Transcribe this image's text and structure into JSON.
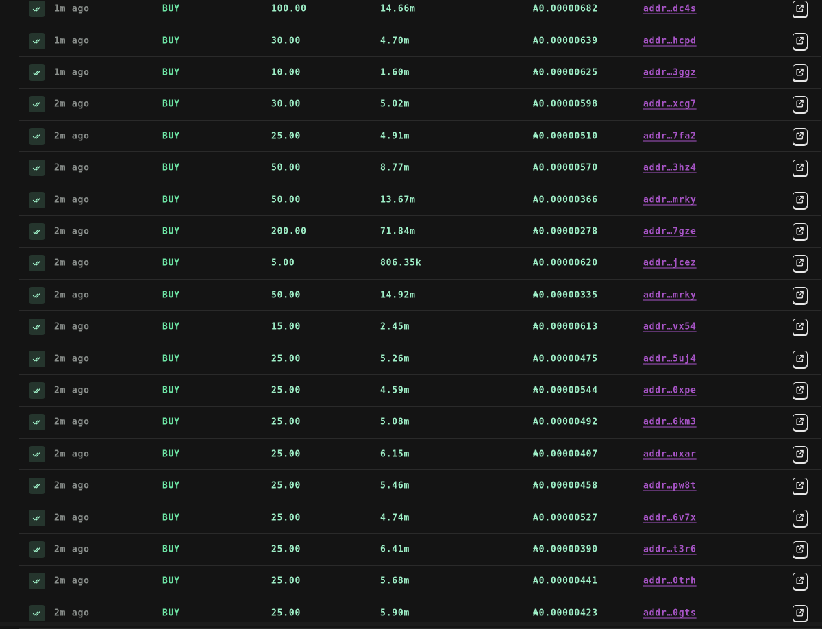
{
  "colors": {
    "background": "#141414",
    "time": "#8a8f8c",
    "type": "#6ee7a6",
    "value": "#9ff0c8",
    "address": "#a855c7",
    "status_bg": "#25352d",
    "divider": "#2a2a2a"
  },
  "icons": {
    "status": "double-check-icon",
    "action": "external-link-icon"
  },
  "trades": [
    {
      "time": "1m ago",
      "type": "BUY",
      "amount": "100.00",
      "tokens": "14.66m",
      "price": "₳0.00000682",
      "address": "addr…dc4s"
    },
    {
      "time": "1m ago",
      "type": "BUY",
      "amount": "30.00",
      "tokens": "4.70m",
      "price": "₳0.00000639",
      "address": "addr…hcpd"
    },
    {
      "time": "1m ago",
      "type": "BUY",
      "amount": "10.00",
      "tokens": "1.60m",
      "price": "₳0.00000625",
      "address": "addr…3ggz"
    },
    {
      "time": "2m ago",
      "type": "BUY",
      "amount": "30.00",
      "tokens": "5.02m",
      "price": "₳0.00000598",
      "address": "addr…xcg7"
    },
    {
      "time": "2m ago",
      "type": "BUY",
      "amount": "25.00",
      "tokens": "4.91m",
      "price": "₳0.00000510",
      "address": "addr…7fa2"
    },
    {
      "time": "2m ago",
      "type": "BUY",
      "amount": "50.00",
      "tokens": "8.77m",
      "price": "₳0.00000570",
      "address": "addr…3hz4"
    },
    {
      "time": "2m ago",
      "type": "BUY",
      "amount": "50.00",
      "tokens": "13.67m",
      "price": "₳0.00000366",
      "address": "addr…mrky"
    },
    {
      "time": "2m ago",
      "type": "BUY",
      "amount": "200.00",
      "tokens": "71.84m",
      "price": "₳0.00000278",
      "address": "addr…7gze"
    },
    {
      "time": "2m ago",
      "type": "BUY",
      "amount": "5.00",
      "tokens": "806.35k",
      "price": "₳0.00000620",
      "address": "addr…jcez"
    },
    {
      "time": "2m ago",
      "type": "BUY",
      "amount": "50.00",
      "tokens": "14.92m",
      "price": "₳0.00000335",
      "address": "addr…mrky"
    },
    {
      "time": "2m ago",
      "type": "BUY",
      "amount": "15.00",
      "tokens": "2.45m",
      "price": "₳0.00000613",
      "address": "addr…vx54"
    },
    {
      "time": "2m ago",
      "type": "BUY",
      "amount": "25.00",
      "tokens": "5.26m",
      "price": "₳0.00000475",
      "address": "addr…5uj4"
    },
    {
      "time": "2m ago",
      "type": "BUY",
      "amount": "25.00",
      "tokens": "4.59m",
      "price": "₳0.00000544",
      "address": "addr…0xpe"
    },
    {
      "time": "2m ago",
      "type": "BUY",
      "amount": "25.00",
      "tokens": "5.08m",
      "price": "₳0.00000492",
      "address": "addr…6km3"
    },
    {
      "time": "2m ago",
      "type": "BUY",
      "amount": "25.00",
      "tokens": "6.15m",
      "price": "₳0.00000407",
      "address": "addr…uxar"
    },
    {
      "time": "2m ago",
      "type": "BUY",
      "amount": "25.00",
      "tokens": "5.46m",
      "price": "₳0.00000458",
      "address": "addr…pw8t"
    },
    {
      "time": "2m ago",
      "type": "BUY",
      "amount": "25.00",
      "tokens": "4.74m",
      "price": "₳0.00000527",
      "address": "addr…6v7x"
    },
    {
      "time": "2m ago",
      "type": "BUY",
      "amount": "25.00",
      "tokens": "6.41m",
      "price": "₳0.00000390",
      "address": "addr…t3r6"
    },
    {
      "time": "2m ago",
      "type": "BUY",
      "amount": "25.00",
      "tokens": "5.68m",
      "price": "₳0.00000441",
      "address": "addr…0trh"
    },
    {
      "time": "2m ago",
      "type": "BUY",
      "amount": "25.00",
      "tokens": "5.90m",
      "price": "₳0.00000423",
      "address": "addr…0gts"
    }
  ]
}
